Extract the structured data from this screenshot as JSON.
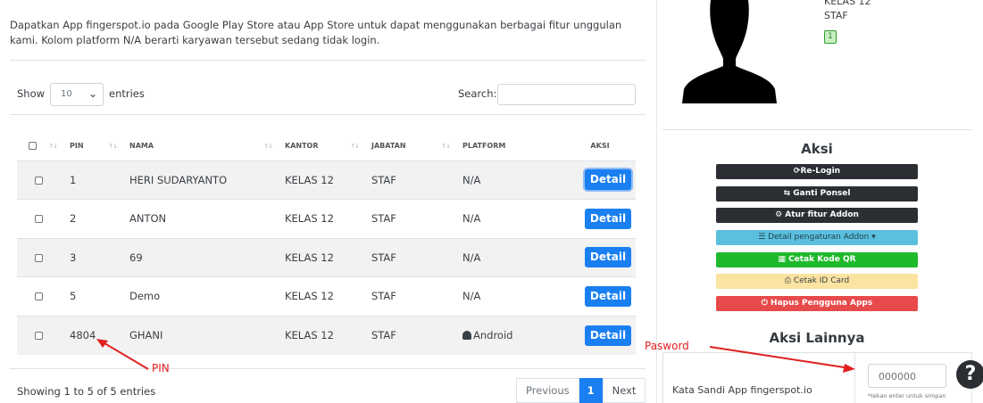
{
  "notice": "Dapatkan App fingerspot.io pada Google Play Store atau App Store untuk dapat menggunakan berbagai fitur unggulan kami. Kolom platform N/A berarti karyawan tersebut sedang tidak login.",
  "controls": {
    "show_label": "Show",
    "entries_value": "10",
    "entries_label": "entries",
    "search_label": "Search:",
    "search_value": ""
  },
  "table": {
    "headers": [
      "PIN",
      "NAMA",
      "KANTOR",
      "JABATAN",
      "PLATFORM",
      "AKSI"
    ],
    "rows": [
      {
        "pin": "1",
        "nama": "HERI SUDARYANTO",
        "kantor": "KELAS 12",
        "jabatan": "STAF",
        "platform": "N/A",
        "aksi": "Detail"
      },
      {
        "pin": "2",
        "nama": "ANTON",
        "kantor": "KELAS 12",
        "jabatan": "STAF",
        "platform": "N/A",
        "aksi": "Detail"
      },
      {
        "pin": "3",
        "nama": "69",
        "kantor": "KELAS 12",
        "jabatan": "STAF",
        "platform": "N/A",
        "aksi": "Detail"
      },
      {
        "pin": "5",
        "nama": "Demo",
        "kantor": "KELAS 12",
        "jabatan": "STAF",
        "platform": "N/A",
        "aksi": "Detail"
      },
      {
        "pin": "4804",
        "nama": "GHANI",
        "kantor": "KELAS 12",
        "jabatan": "STAF",
        "platform": "Android",
        "aksi": "Detail"
      }
    ]
  },
  "footer": {
    "showing": "Showing 1 to 5 of 5 entries",
    "previous": "Previous",
    "page": "1",
    "next": "Next"
  },
  "profile": {
    "kantor": "KELAS 12",
    "jabatan": "STAF",
    "badge": "1"
  },
  "aksi": {
    "title": "Aksi",
    "relogin": "Re-Login",
    "ganti_ponsel": "Ganti Ponsel",
    "atur_fitur": "Atur fitur Addon",
    "detail_pengaturan": "Detail pengaturan Addon",
    "cetak_qr": "Cetak Kode QR",
    "cetak_id": "Cetak ID Card",
    "hapus": "Hapus Pengguna Apps"
  },
  "aksi_lainnya": {
    "title": "Aksi Lainnya",
    "sandi_label": "Kata Sandi App fingerspot.io",
    "password_placeholder": "000000",
    "hint": "*tekan enter untuk simpan"
  },
  "annotations": {
    "pin": "PIN",
    "password": "Pasword"
  },
  "colors": {
    "primary": "#1a7ff0",
    "danger": "#e74a4a",
    "success": "#1fb92c",
    "info": "#5bc0de",
    "warning": "#fbe3a1",
    "annotation": "#e02020"
  }
}
